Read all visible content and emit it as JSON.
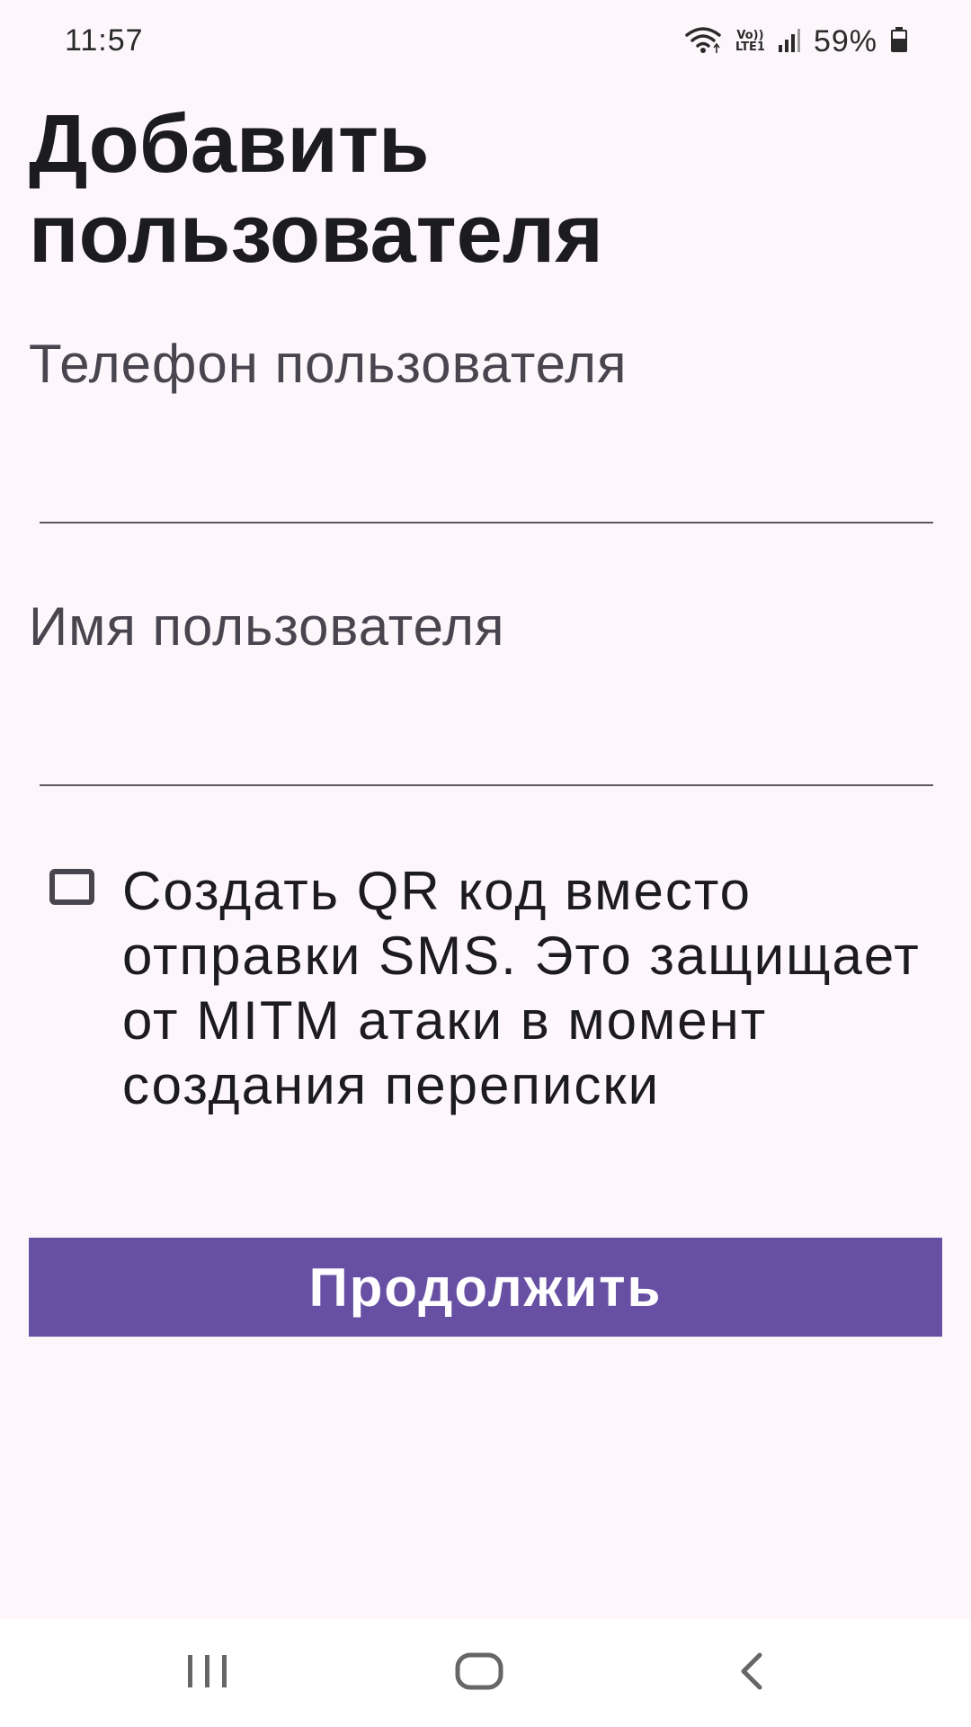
{
  "status_bar": {
    "time": "11:57",
    "battery_percent": "59%",
    "network_top": "Vo))",
    "network_bottom": "LTE1",
    "icons": [
      "wifi-icon",
      "volte-icon",
      "signal-icon",
      "battery-icon"
    ]
  },
  "page": {
    "title": "Добавить пользователя"
  },
  "form": {
    "phone_label": "Телефон пользователя",
    "phone_value": "",
    "name_label": "Имя пользователя",
    "name_value": "",
    "qr_checkbox_label": "Создать QR код вместо отправки SMS. Это защищает от MITM атаки в момент создания переписки",
    "qr_checkbox_checked": false,
    "submit_label": "Продолжить"
  },
  "nav_bar": {
    "icons": [
      "recents-icon",
      "home-icon",
      "back-icon"
    ]
  },
  "colors": {
    "background": "#fdf7fc",
    "primary": "#6750a4",
    "label": "#49454f",
    "text": "#1c1b1f"
  }
}
